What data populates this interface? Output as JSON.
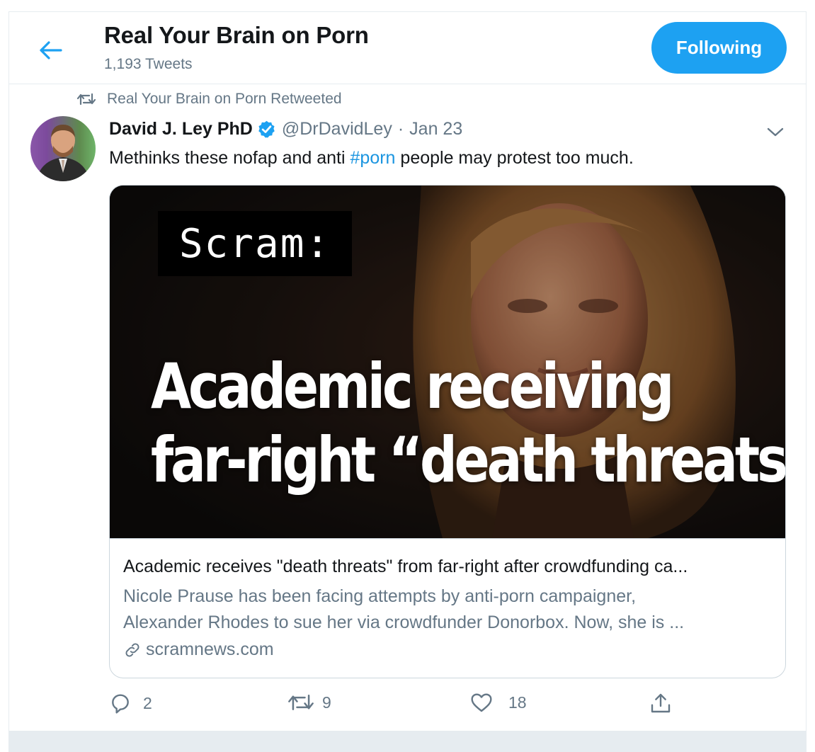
{
  "header": {
    "title": "Real Your Brain on Porn",
    "tweet_count": "1,193 Tweets",
    "follow_label": "Following"
  },
  "tweet": {
    "retweeted_by": "Real Your Brain on Porn Retweeted",
    "author_name": "David J. Ley PhD",
    "handle": "@DrDavidLey",
    "separator": "·",
    "date": "Jan 23",
    "text_before": "Methinks these nofap and anti ",
    "hashtag": "#porn",
    "text_after": " people may protest too much.",
    "card": {
      "image_brand": "Scram:",
      "image_headline_line1": "Academic receiving",
      "image_headline_line2": "far-right “death threats”",
      "title": "Academic receives \"death threats\" from far-right after crowdfunding ca...",
      "description_line1": "Nicole Prause has been facing attempts by anti-porn campaigner,",
      "description_line2": "Alexander Rhodes to sue her via crowdfunder Donorbox. Now, she is ...",
      "domain": "scramnews.com"
    },
    "actions": {
      "replies": "2",
      "retweets": "9",
      "likes": "18"
    }
  },
  "colors": {
    "accent": "#1da1f2",
    "hashtag": "#1b95e0",
    "secondary_text": "#657786",
    "border": "#e6ecf0"
  }
}
